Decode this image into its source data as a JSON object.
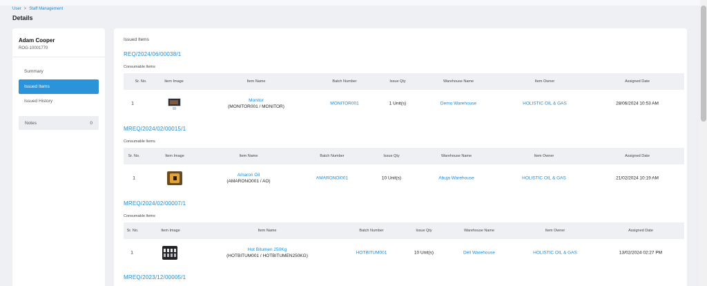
{
  "breadcrumb": {
    "items": [
      "User",
      "Staff Management"
    ],
    "separator": ">"
  },
  "page_title": "Details",
  "user": {
    "name": "Adam Cooper",
    "id": "ROG-10001770"
  },
  "nav": {
    "items": [
      {
        "label": "Summary",
        "active": false
      },
      {
        "label": "Issued Items",
        "active": true
      },
      {
        "label": "Issued History",
        "active": false
      }
    ],
    "notes": {
      "label": "Notes",
      "count": "0"
    }
  },
  "main": {
    "title": "Issued Items",
    "sections": [
      {
        "req": "REQ/2024/06/00038/1",
        "subtitle": "Consumable Items",
        "headers": [
          "Sr. No.",
          "Item Image",
          "Item Name",
          "Batch Number",
          "Issue Qty",
          "Warehouse Name",
          "Item Owner",
          "Assigned Date"
        ],
        "row": {
          "sr": "1",
          "image_icon": "monitor-image",
          "name": "Monitor",
          "code": "(MONITOR001 / MONITOR)",
          "batch": "MONITOR001",
          "qty": "1 Unit(s)",
          "warehouse": "Demo Warehouse",
          "owner": "HOLISTIC OIL & GAS",
          "date": "28/06/2024 10:53 AM"
        }
      },
      {
        "req": "MREQ/2024/02/00015/1",
        "subtitle": "Consumable Items",
        "headers": [
          "Sr. No.",
          "Item Image",
          "Item Name",
          "Batch Number",
          "Issue Qty",
          "Warehouse Name",
          "Item Owner",
          "Assigned Date"
        ],
        "row": {
          "sr": "1",
          "image_icon": "oil-can-image",
          "name": "Amaron Oil",
          "code": "(AMARONO001 / AO)",
          "batch": "AMARONOI001",
          "qty": "10 Unit(s)",
          "warehouse": "Abuja Warehouse",
          "owner": "HOLISTIC OIL & GAS",
          "date": "21/02/2024 10:19 AM"
        }
      },
      {
        "req": "MREQ/2024/02/00007/1",
        "subtitle": "Consumable Items",
        "headers": [
          "Sr. No.",
          "Item Image",
          "Item Name",
          "Batch Number",
          "Issue Qty",
          "Warehouse Name",
          "Item Owner",
          "Assigned Date"
        ],
        "row": {
          "sr": "1",
          "image_icon": "bitumen-image",
          "name": "Hot Bitumen 250Kg",
          "code": "(HOTBITUM001 / HOTBITUMEN250KG)",
          "batch": "HOTBITUM001",
          "qty": "10 Unit(s)",
          "warehouse": "Dell Warehouse",
          "owner": "HOLISTIC OIL & GAS",
          "date": "13/02/2024 02:27 PM"
        }
      },
      {
        "req": "MREQ/2023/12/00005/1"
      }
    ]
  }
}
